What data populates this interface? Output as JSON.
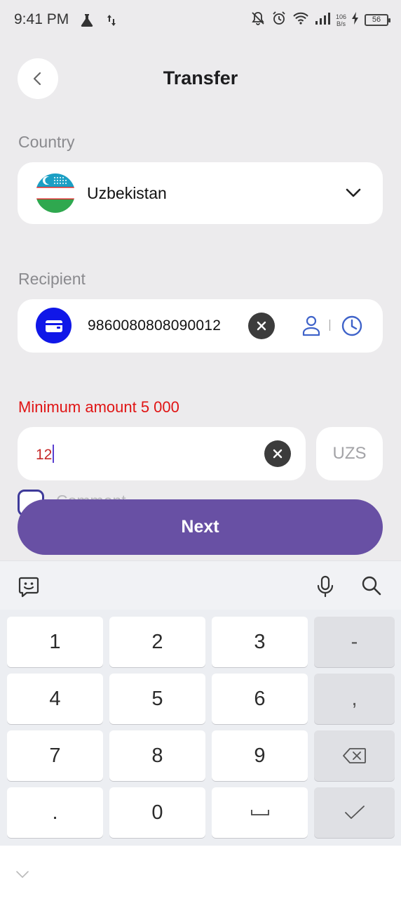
{
  "status_bar": {
    "time": "9:41 PM",
    "speed_value": "106",
    "speed_unit": "B/s",
    "battery": "56"
  },
  "header": {
    "title": "Transfer"
  },
  "country": {
    "label": "Country",
    "selected": "Uzbekistan"
  },
  "recipient": {
    "label": "Recipient",
    "number": "9860080808090012"
  },
  "amount": {
    "error": "Minimum amount 5 000",
    "value": "12",
    "currency": "UZS"
  },
  "comment": {
    "label_partial": "Comment"
  },
  "actions": {
    "next_label": "Next"
  },
  "keyboard": {
    "keys": {
      "k1": "1",
      "k2": "2",
      "k3": "3",
      "dash": "-",
      "k4": "4",
      "k5": "5",
      "k6": "6",
      "comma": ",",
      "k7": "7",
      "k8": "8",
      "k9": "9",
      "dot": ".",
      "k0": "0"
    }
  },
  "colors": {
    "primary": "#6850a4",
    "error": "#e01414",
    "wallet_badge": "#1017e8",
    "accent_icon": "#3f63c9"
  }
}
